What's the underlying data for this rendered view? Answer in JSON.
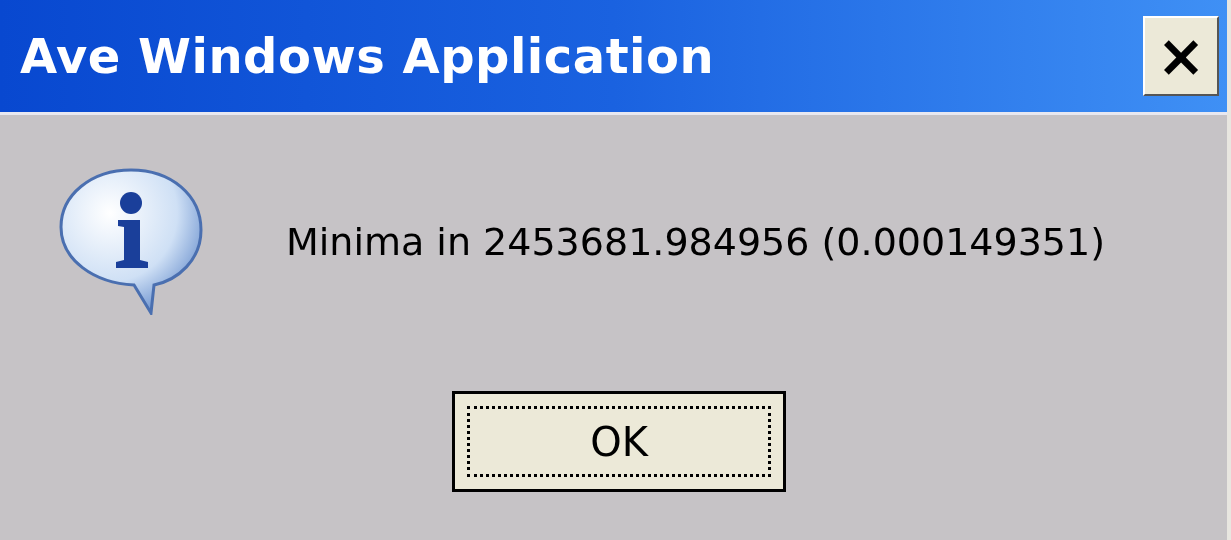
{
  "window": {
    "title": "Ave Windows Application",
    "close_button": "×"
  },
  "message": {
    "text": "Minima in 2453681.984956 (0.000149351)"
  },
  "buttons": [
    {
      "label": "OK",
      "focused": true
    }
  ]
}
